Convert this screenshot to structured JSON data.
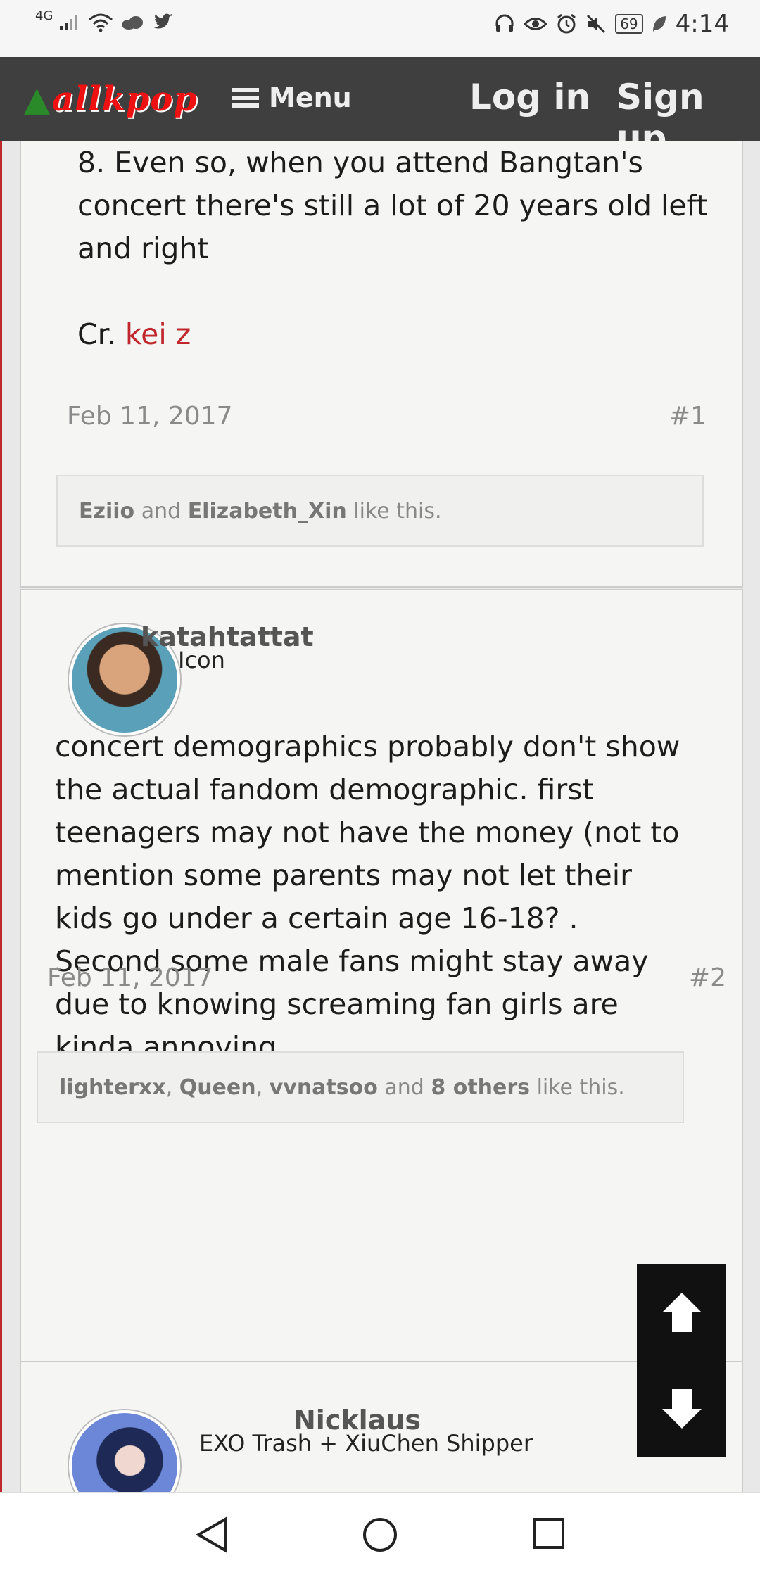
{
  "status_bar": {
    "network": "4G",
    "battery": "69",
    "time": "4:14"
  },
  "header": {
    "logo_text": "allkpop",
    "menu_label": "Menu",
    "login_label": "Log in",
    "signup_label": "Sign up"
  },
  "posts": [
    {
      "text_lines": [
        "8. Even so, when you attend Bangtan's",
        "concert there's still a lot of 20 years old left",
        "and right"
      ],
      "credit_prefix": "Cr.",
      "credit_name": "kei z",
      "date": "Feb 11, 2017",
      "number": "#1",
      "likes": {
        "users": [
          "Eziio",
          "Elizabeth_Xin"
        ],
        "connector": "and",
        "suffix": "like this."
      }
    },
    {
      "username": "katahtattat",
      "user_title": "Icon",
      "text": "concert demographics probably don't show the actual fandom demographic. first teenagers may not have the money (not to mention some parents may not let their kids go under a certain age 16-18? . Second some male fans might stay away due to knowing screaming fan girls are kinda annoying.",
      "date": "Feb 11, 2017",
      "number": "#2",
      "likes": {
        "users": [
          "lighterxx",
          "Queen",
          "vvnatsoo"
        ],
        "sep": ",",
        "connector": "and",
        "others": "8 others",
        "suffix": "like this."
      }
    },
    {
      "username": "Nicklaus",
      "user_title": "EXO Trash + XiuChen Shipper"
    }
  ],
  "colors": {
    "accent": "#c0272d",
    "header_bg": "#3f3f3f",
    "post_bg": "#f5f5f3"
  },
  "icons": [
    "headset-icon",
    "eye-icon",
    "alarm-icon",
    "mute-icon",
    "battery-icon",
    "leaf-icon",
    "wifi-icon",
    "cloud-icon",
    "twitter-icon"
  ]
}
